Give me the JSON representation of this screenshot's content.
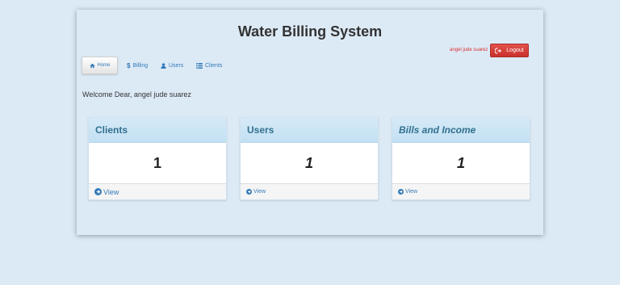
{
  "header": {
    "title": "Water Billing System"
  },
  "user": {
    "name": "angel jude suarez",
    "logout_label": "Logout"
  },
  "nav": {
    "items": [
      {
        "label": "Home",
        "icon": "home-icon",
        "active": true
      },
      {
        "label": "Billing",
        "icon": "dollar-icon"
      },
      {
        "label": "Users",
        "icon": "user-icon"
      },
      {
        "label": "Clients",
        "icon": "list-icon"
      }
    ]
  },
  "welcome": "Welcome Dear, angel jude suarez",
  "panels": [
    {
      "title": "Clients",
      "value": "1",
      "link": "View"
    },
    {
      "title": "Users",
      "value": "1",
      "link": "View"
    },
    {
      "title": "Bills and Income",
      "value": "1",
      "link": "View"
    }
  ],
  "colors": {
    "accent": "#337ab7",
    "danger": "#d9312b",
    "panel_heading": "#31708f"
  }
}
